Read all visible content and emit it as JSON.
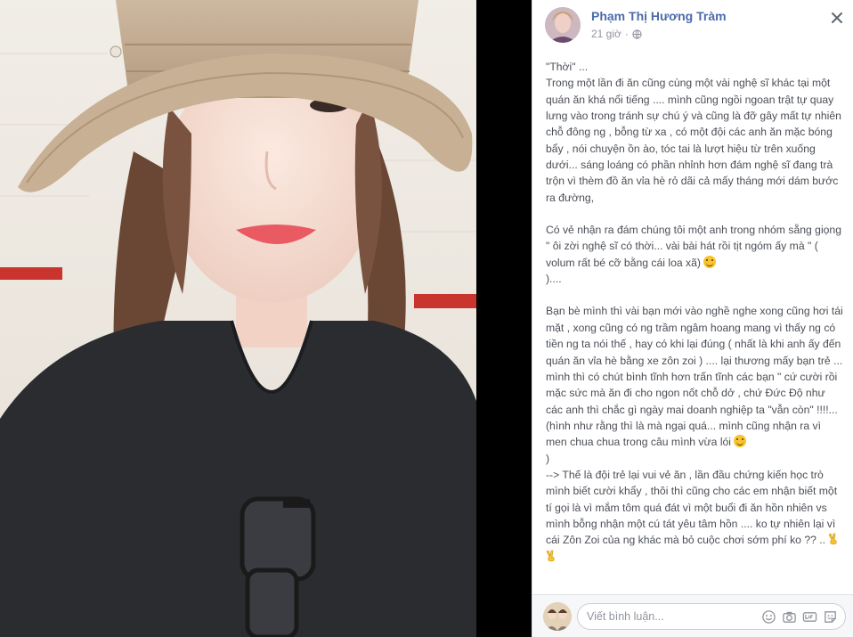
{
  "post": {
    "author": "Phạm Thị Hương Tràm",
    "time": "21 giờ",
    "privacy_icon": "globe-icon",
    "close_icon": "close-icon",
    "paragraphs": [
      {
        "lines": [
          "\"Thời\" ...",
          "Trong một lần đi ăn cũng cùng một vài nghệ sĩ khác tại một quán ăn khá nổi tiếng .... mình cũng ngồi ngoan trật tự quay lưng vào trong tránh sự chú ý và cũng là đỡ gây mất tự nhiên chỗ đông ng , bỗng từ xa , có một đội các anh ăn mặc bóng bẩy , nói chuyện ồn ào, tóc tai là lượt hiệu từ trên xuống dưới... sáng loáng có phần nhỉnh hơn đám nghệ sĩ đang trà trộn vì thèm đồ ăn vỉa hè rỏ dãi cả mấy tháng mới dám bước ra đường,"
        ]
      },
      {
        "text": "Có vẻ nhận ra đám chúng tôi một anh trong nhóm sẵng giọng \" ôi zời nghệ sĩ có thời... vài bài hát rồi tịt ngóm ấy mà \" ( volum rất bé cỡ bằng cái loa xã)",
        "tail": ")...."
      },
      {
        "text": "Bạn bè mình thì vài bạn mới vào nghề nghe xong cũng hơi tái mặt , xong cũng có ng trầm ngâm hoang mang vì thấy ng có tiền ng ta nói thế , hay có khi lại đúng ( nhất là khi anh ấy đến quán ăn vỉa hè bằng xe zôn zoi ) .... lại thương mấy bạn trẻ ... mình thì có chút bình tĩnh hơn trấn tĩnh các bạn \" cứ cười rồi mặc sức mà ăn đi cho ngon nốt chỗ dở , chứ Đức Độ như các anh thì chắc gì ngày mai doanh nghiệp ta \"vẫn còn\" !!!!...(hình như rằng thì là mà ngại quá... mình cũng nhận ra vì men chua chua trong câu mình vừa lói",
        "tail": ")"
      },
      {
        "text": "--> Thế là đội trẻ lại vui vẻ ăn , lần đầu chứng kiến học trò mình biết cười khẩy , thôi thì cũng cho các em nhận biết một tí gọi là vì mắm tôm quá đát vì một buổi đi ăn hồn nhiên vs mình bỗng nhận một cú tát yêu tâm hồn .... ko tự nhiên lại vì cái Zôn Zoi của ng khác mà bỏ cuộc chơi sớm phí ko ?? .."
      }
    ]
  },
  "comment": {
    "placeholder": "Viết bình luận...",
    "icons": [
      "emoji-icon",
      "camera-icon",
      "gif-icon",
      "sticker-icon"
    ]
  },
  "colors": {
    "author": "#4b6bab",
    "meta": "#90949c",
    "body_text": "#4b4f56",
    "panel_bg": "#ffffff",
    "comment_bar_bg": "#f6f7f9"
  }
}
